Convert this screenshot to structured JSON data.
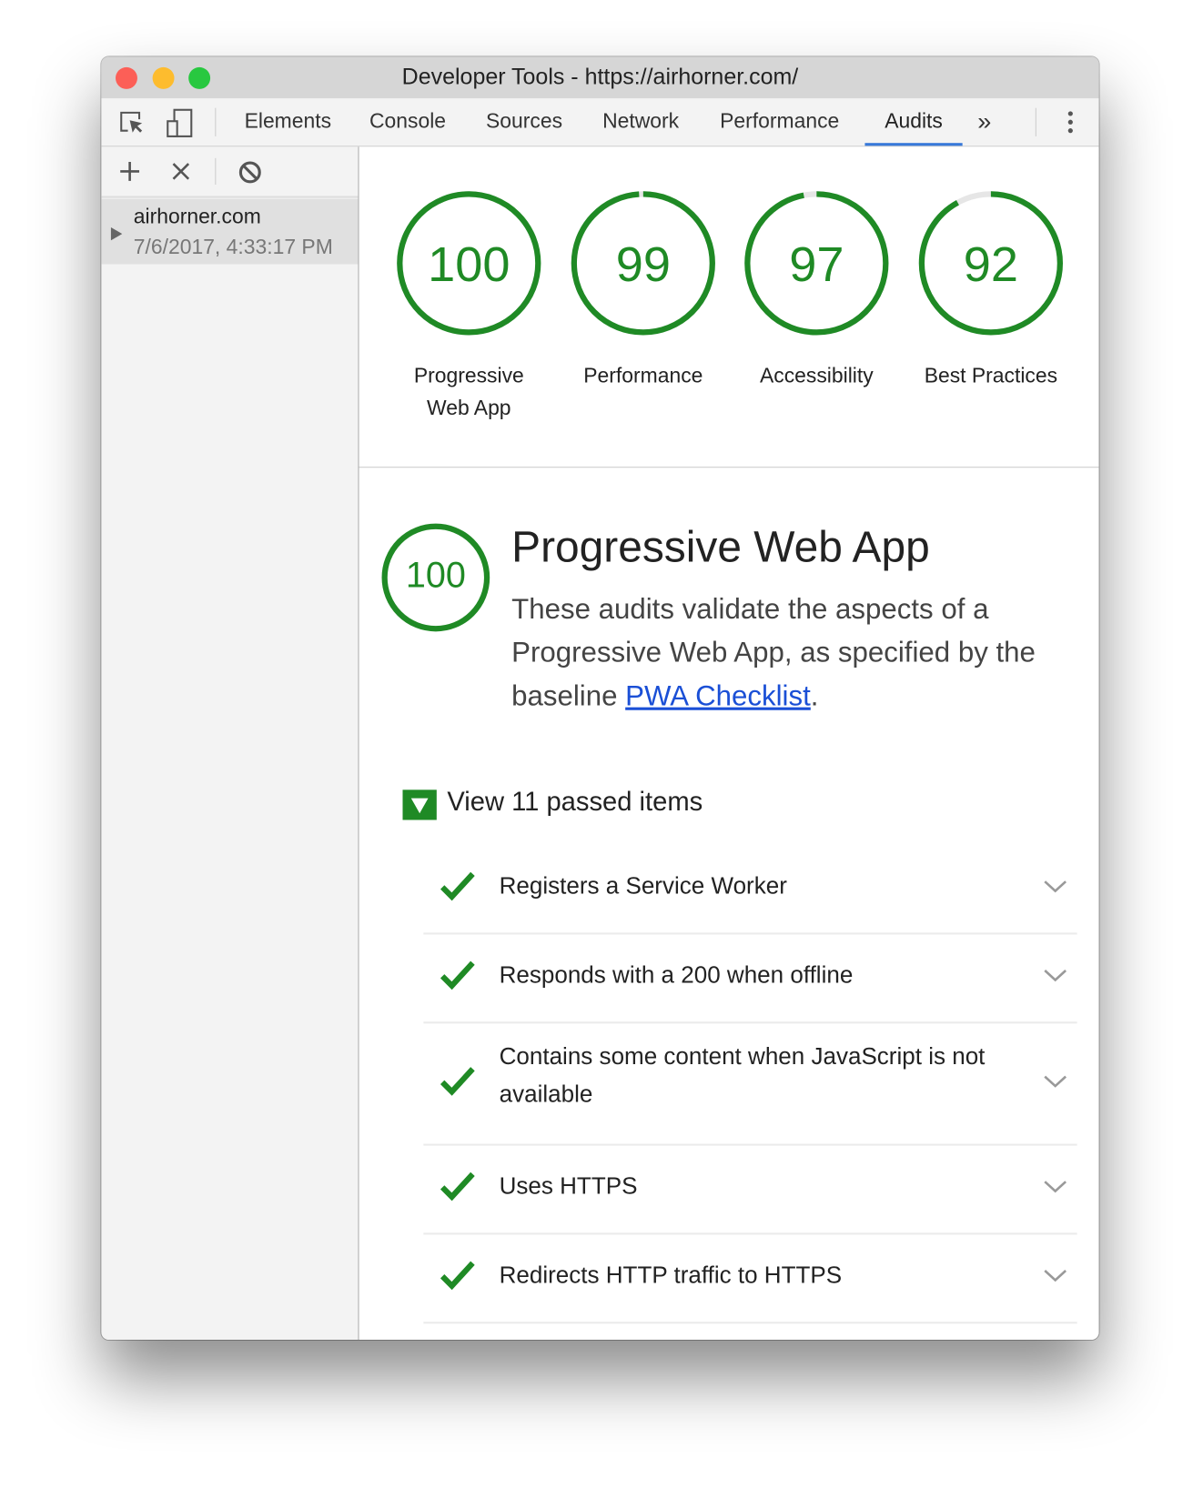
{
  "window": {
    "title": "Developer Tools - https://airhorner.com/"
  },
  "toolbar": {
    "tabs": [
      "Elements",
      "Console",
      "Sources",
      "Network",
      "Performance",
      "Audits"
    ],
    "active_tab": "Audits",
    "overflow": "»"
  },
  "sidebar": {
    "report": {
      "site": "airhorner.com",
      "timestamp": "7/6/2017, 4:33:17 PM"
    }
  },
  "scores": [
    {
      "label": "Progressive Web App",
      "value": "100"
    },
    {
      "label": "Performance",
      "value": "99"
    },
    {
      "label": "Accessibility",
      "value": "97"
    },
    {
      "label": "Best Practices",
      "value": "92"
    }
  ],
  "section": {
    "score": "100",
    "title": "Progressive Web App",
    "desc_before": "These audits validate the aspects of a Progressive Web App, as specified by the baseline ",
    "link": "PWA Checklist",
    "desc_after": ".",
    "passed_toggle": "View 11 passed items",
    "audits": [
      "Registers a Service Worker",
      "Responds with a 200 when offline",
      "Contains some content when JavaScript is not available",
      "Uses HTTPS",
      "Redirects HTTP traffic to HTTPS"
    ]
  },
  "colors": {
    "pass": "#1f8a25",
    "accent": "#3879d9",
    "link": "#1a4fd6"
  }
}
